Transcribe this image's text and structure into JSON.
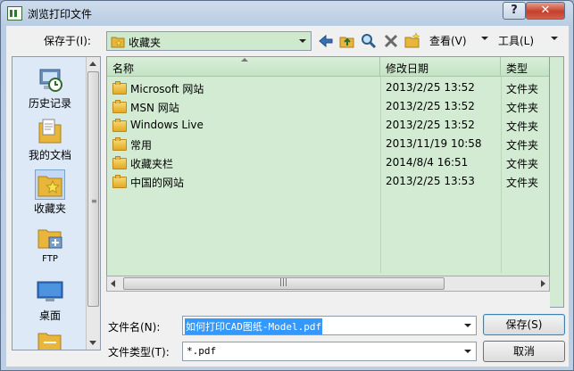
{
  "window": {
    "title": "浏览打印文件",
    "help_label": "?",
    "close_label": "✕"
  },
  "toolbar": {
    "location_label": "保存于(I):",
    "location_value": "收藏夹",
    "view_label": "查看(V)",
    "tools_label": "工具(L)"
  },
  "places": [
    {
      "label": "历史记录",
      "icon": "history-icon"
    },
    {
      "label": "我的文档",
      "icon": "documents-icon"
    },
    {
      "label": "收藏夹",
      "icon": "favorites-icon",
      "selected": true
    },
    {
      "label": "FTP",
      "icon": "ftp-icon"
    },
    {
      "label": "桌面",
      "icon": "desktop-icon"
    }
  ],
  "files": {
    "columns": [
      "名称",
      "修改日期",
      "类型"
    ],
    "rows": [
      {
        "name": "Microsoft 网站",
        "date": "2013/2/25 13:52",
        "type": "文件夹"
      },
      {
        "name": "MSN 网站",
        "date": "2013/2/25 13:52",
        "type": "文件夹"
      },
      {
        "name": "Windows Live",
        "date": "2013/2/25 13:52",
        "type": "文件夹"
      },
      {
        "name": "常用",
        "date": "2013/11/19 10:58",
        "type": "文件夹"
      },
      {
        "name": "收藏夹栏",
        "date": "2014/8/4 16:51",
        "type": "文件夹"
      },
      {
        "name": "中国的网站",
        "date": "2013/2/25 13:53",
        "type": "文件夹"
      }
    ]
  },
  "form": {
    "filename_label": "文件名(N):",
    "filename_value": "如何打印CAD图纸-Model.pdf",
    "filetype_label": "文件类型(T):",
    "filetype_value": "*.pdf",
    "save_label": "保存(S)",
    "cancel_label": "取消"
  },
  "colors": {
    "list_bg": "#d2ebd2",
    "accent": "#3399ff",
    "close": "#c5402a"
  }
}
